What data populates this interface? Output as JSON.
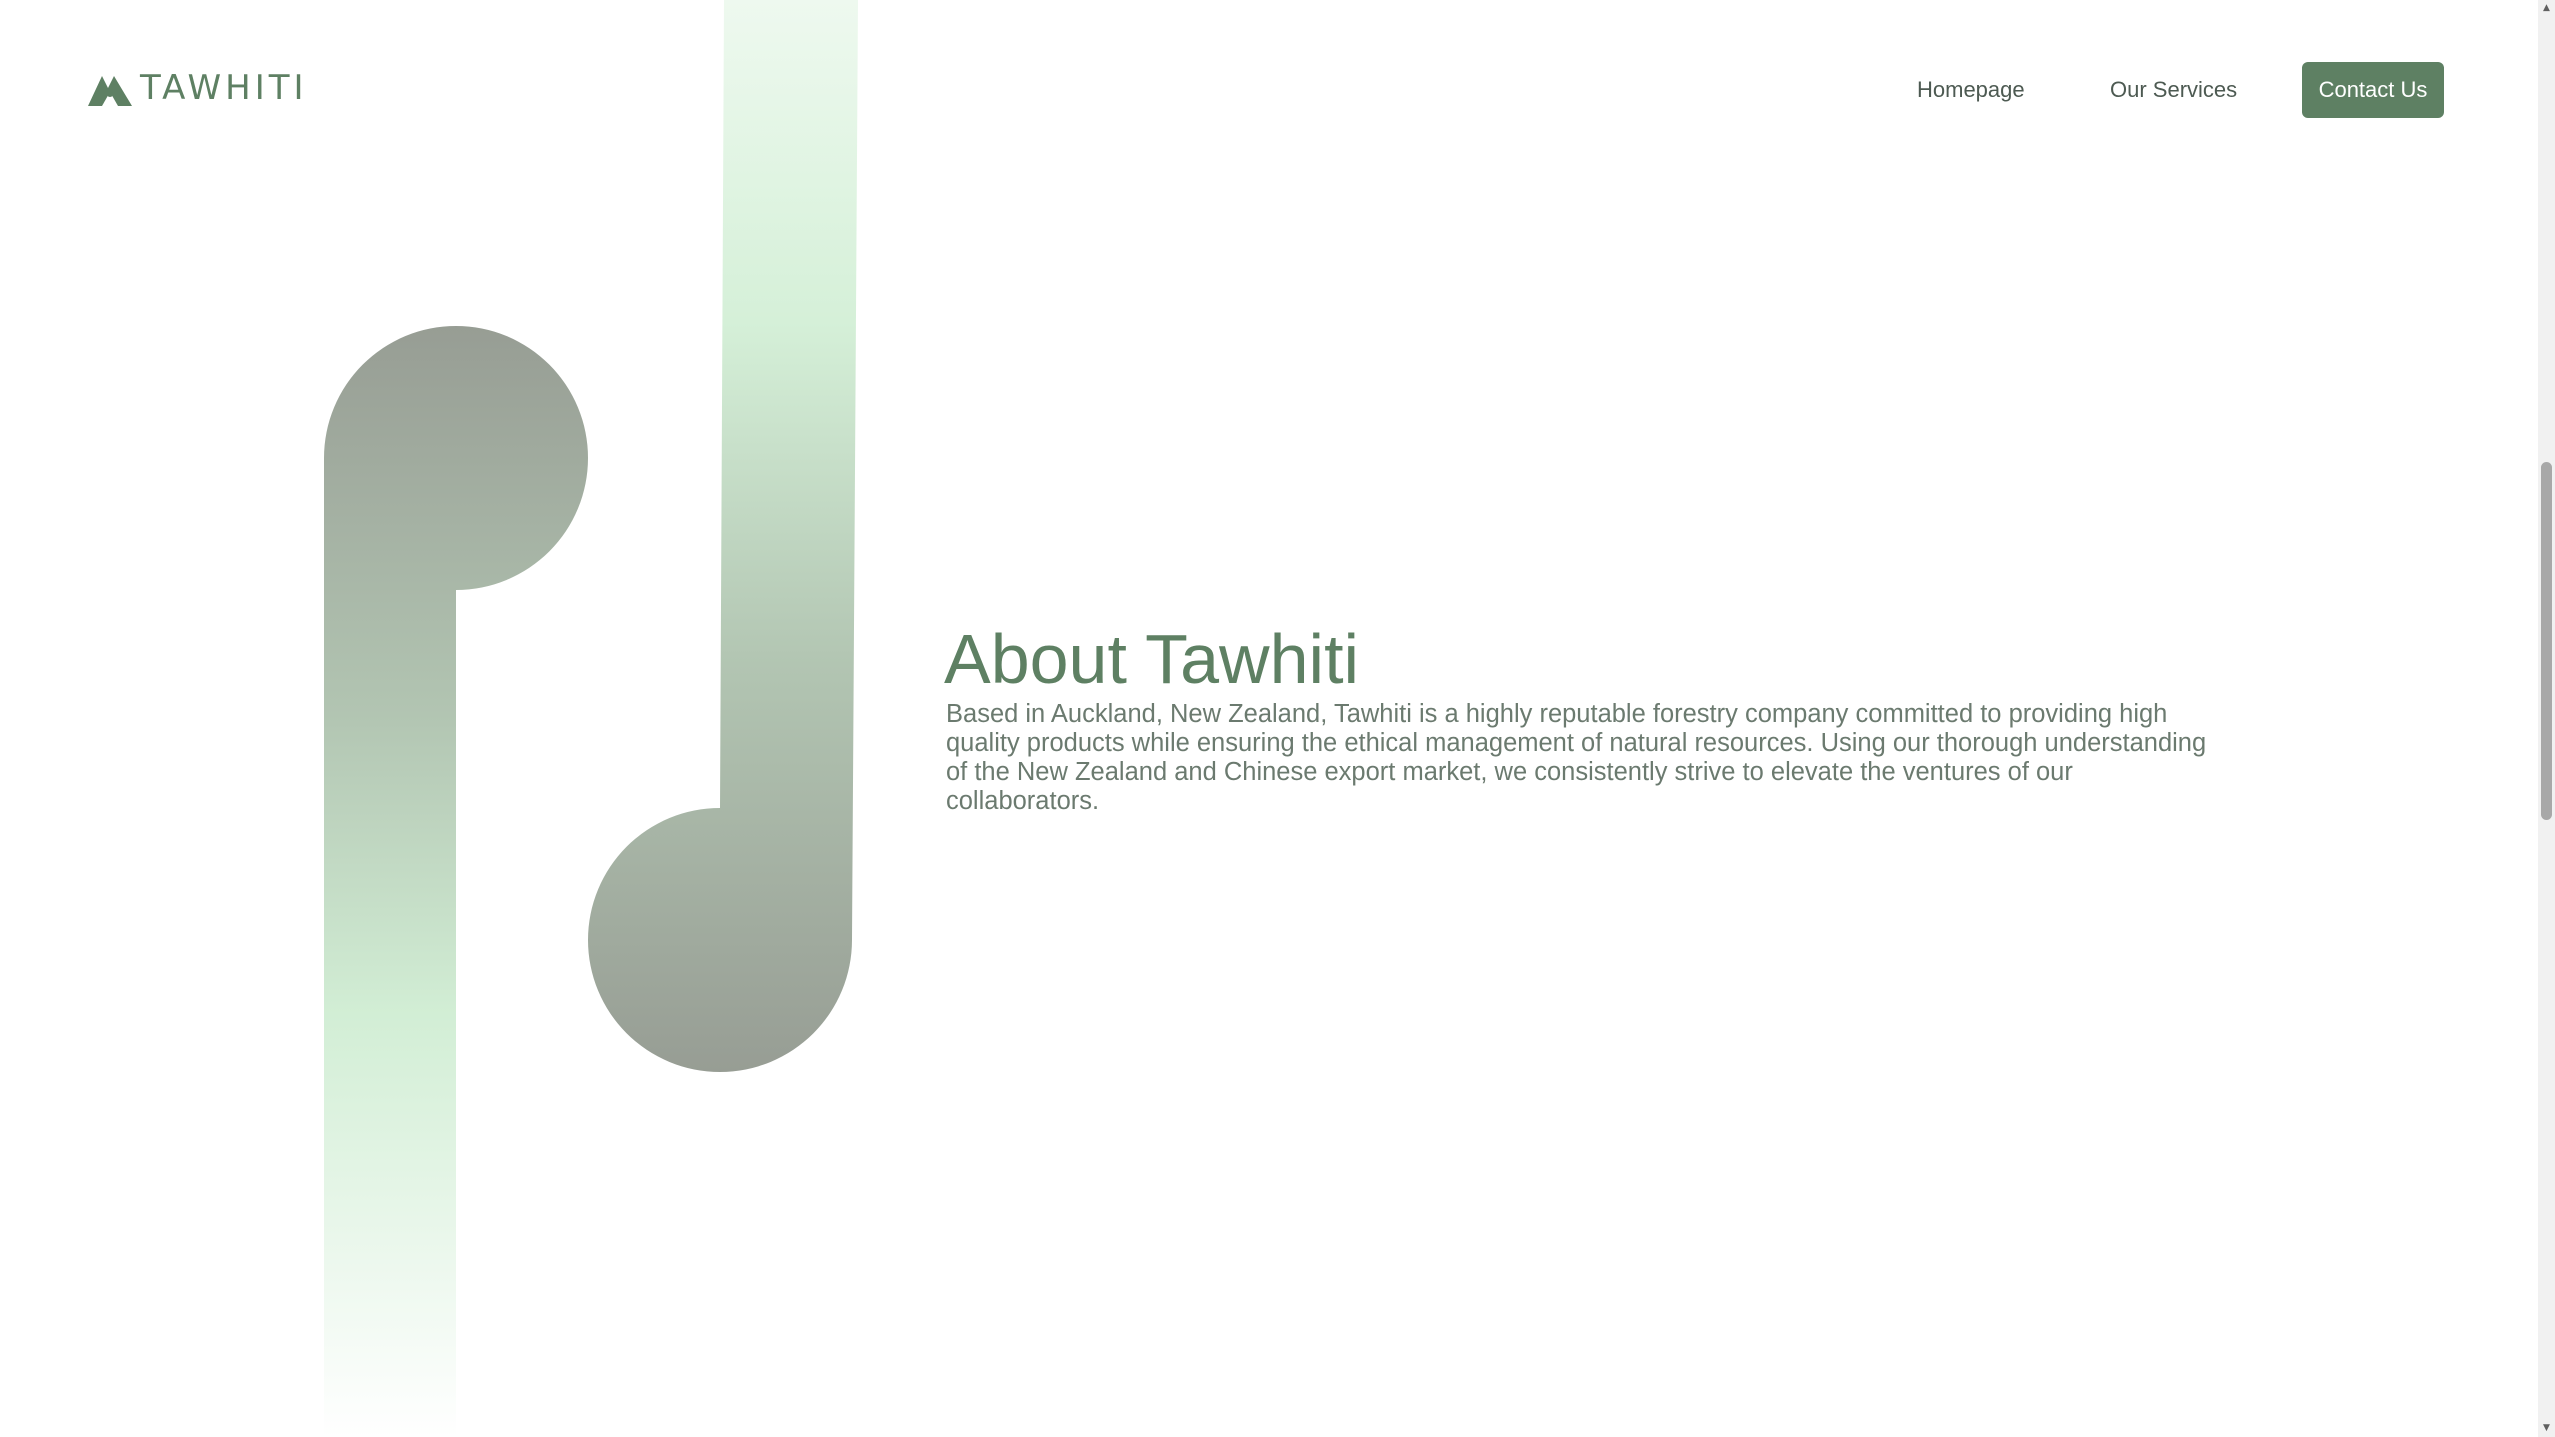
{
  "header": {
    "brand": "TAWHITI",
    "logo_icon": "tree-mountain-logo-icon",
    "nav": {
      "home_label": "Homepage",
      "services_label": "Our Services",
      "contact_label": "Contact Us"
    }
  },
  "about": {
    "title": "About Tawhiti",
    "body": "Based in Auckland, New Zealand, Tawhiti is a highly reputable forestry company committed to providing high quality products while ensuring the ethical management of natural resources. Using our thorough understanding of the New Zealand and Chinese export market, we consistently strive to elevate the ventures of our collaborators."
  },
  "scrollbar": {
    "up_icon": "scroll-up-arrow-icon",
    "down_icon": "scroll-down-arrow-icon"
  },
  "colors": {
    "brand_green": "#5e8063",
    "text_grey": "#6b7a6f",
    "nav_text": "#4d5a52",
    "deco_grey": "#979d94",
    "deco_light_green": "#d5f0d8"
  }
}
